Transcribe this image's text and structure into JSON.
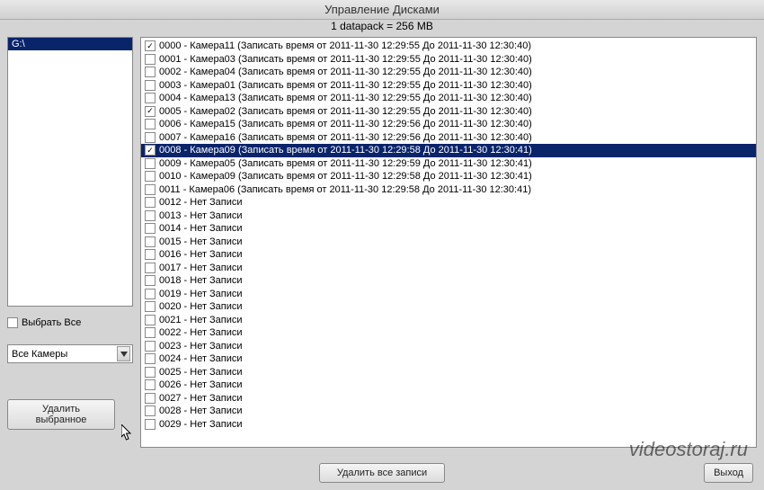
{
  "window": {
    "title": "Управление Дисками",
    "info": "1 datapack = 256 MB"
  },
  "sidebar": {
    "drive": "G:\\",
    "select_all_label": "Выбрать Все",
    "select_all_checked": false,
    "camera_filter": "Все Камеры",
    "delete_selected_label": "Удалить выбранное"
  },
  "records": [
    {
      "checked": true,
      "id": "0000",
      "name": "Камера11",
      "desc": "(Записать время от 2011-11-30 12:29:55 До 2011-11-30 12:30:40)",
      "selected": false
    },
    {
      "checked": false,
      "id": "0001",
      "name": "Камера03",
      "desc": "(Записать время от 2011-11-30 12:29:55 До 2011-11-30 12:30:40)",
      "selected": false
    },
    {
      "checked": false,
      "id": "0002",
      "name": "Камера04",
      "desc": "(Записать время от 2011-11-30 12:29:55 До 2011-11-30 12:30:40)",
      "selected": false
    },
    {
      "checked": false,
      "id": "0003",
      "name": "Камера01",
      "desc": "(Записать время от 2011-11-30 12:29:55 До 2011-11-30 12:30:40)",
      "selected": false
    },
    {
      "checked": false,
      "id": "0004",
      "name": "Камера13",
      "desc": "(Записать время от 2011-11-30 12:29:55 До 2011-11-30 12:30:40)",
      "selected": false
    },
    {
      "checked": true,
      "id": "0005",
      "name": "Камера02",
      "desc": "(Записать время от 2011-11-30 12:29:55 До 2011-11-30 12:30:40)",
      "selected": false
    },
    {
      "checked": false,
      "id": "0006",
      "name": "Камера15",
      "desc": "(Записать время от 2011-11-30 12:29:56 До 2011-11-30 12:30:40)",
      "selected": false
    },
    {
      "checked": false,
      "id": "0007",
      "name": "Камера16",
      "desc": "(Записать время от 2011-11-30 12:29:56 До 2011-11-30 12:30:40)",
      "selected": false
    },
    {
      "checked": true,
      "id": "0008",
      "name": "Камера09",
      "desc": "(Записать время от 2011-11-30 12:29:58 До 2011-11-30 12:30:41)",
      "selected": true
    },
    {
      "checked": false,
      "id": "0009",
      "name": "Камера05",
      "desc": "(Записать время от 2011-11-30 12:29:59 До 2011-11-30 12:30:41)",
      "selected": false
    },
    {
      "checked": false,
      "id": "0010",
      "name": "Камера09",
      "desc": "(Записать время от 2011-11-30 12:29:58 До 2011-11-30 12:30:41)",
      "selected": false
    },
    {
      "checked": false,
      "id": "0011",
      "name": "Камера06",
      "desc": "(Записать время от 2011-11-30 12:29:58 До 2011-11-30 12:30:41)",
      "selected": false
    },
    {
      "checked": false,
      "id": "0012",
      "name": "Нет Записи",
      "desc": "",
      "selected": false
    },
    {
      "checked": false,
      "id": "0013",
      "name": "Нет Записи",
      "desc": "",
      "selected": false
    },
    {
      "checked": false,
      "id": "0014",
      "name": "Нет Записи",
      "desc": "",
      "selected": false
    },
    {
      "checked": false,
      "id": "0015",
      "name": "Нет Записи",
      "desc": "",
      "selected": false
    },
    {
      "checked": false,
      "id": "0016",
      "name": "Нет Записи",
      "desc": "",
      "selected": false
    },
    {
      "checked": false,
      "id": "0017",
      "name": "Нет Записи",
      "desc": "",
      "selected": false
    },
    {
      "checked": false,
      "id": "0018",
      "name": "Нет Записи",
      "desc": "",
      "selected": false
    },
    {
      "checked": false,
      "id": "0019",
      "name": "Нет Записи",
      "desc": "",
      "selected": false
    },
    {
      "checked": false,
      "id": "0020",
      "name": "Нет Записи",
      "desc": "",
      "selected": false
    },
    {
      "checked": false,
      "id": "0021",
      "name": "Нет Записи",
      "desc": "",
      "selected": false
    },
    {
      "checked": false,
      "id": "0022",
      "name": "Нет Записи",
      "desc": "",
      "selected": false
    },
    {
      "checked": false,
      "id": "0023",
      "name": "Нет Записи",
      "desc": "",
      "selected": false
    },
    {
      "checked": false,
      "id": "0024",
      "name": "Нет Записи",
      "desc": "",
      "selected": false
    },
    {
      "checked": false,
      "id": "0025",
      "name": "Нет Записи",
      "desc": "",
      "selected": false
    },
    {
      "checked": false,
      "id": "0026",
      "name": "Нет Записи",
      "desc": "",
      "selected": false
    },
    {
      "checked": false,
      "id": "0027",
      "name": "Нет Записи",
      "desc": "",
      "selected": false
    },
    {
      "checked": false,
      "id": "0028",
      "name": "Нет Записи",
      "desc": "",
      "selected": false
    },
    {
      "checked": false,
      "id": "0029",
      "name": "Нет Записи",
      "desc": "",
      "selected": false
    }
  ],
  "footer": {
    "delete_all_label": "Удалить все записи",
    "exit_label": "Выход"
  },
  "watermark": "videostoraj.ru"
}
